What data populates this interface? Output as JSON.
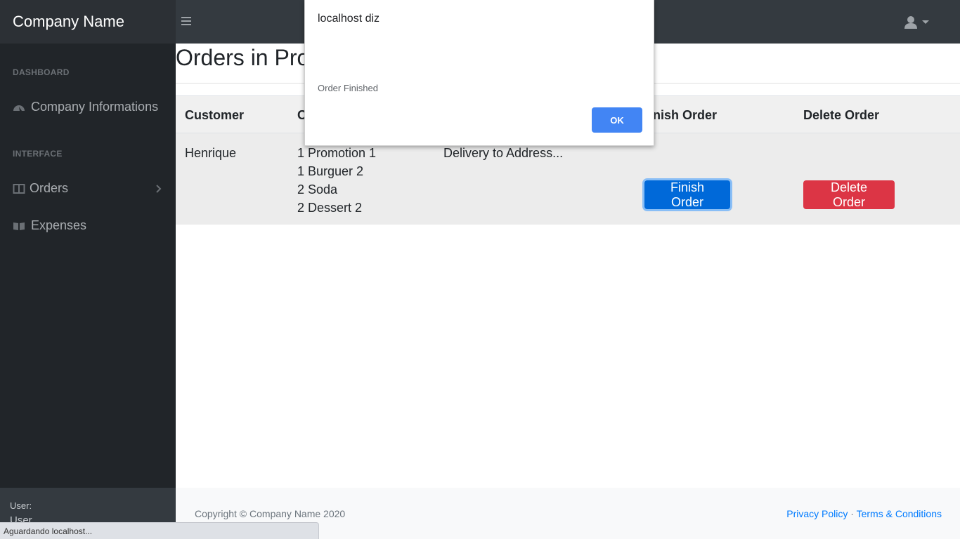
{
  "navbar": {
    "brand": "Company Name"
  },
  "sidebar": {
    "headings": [
      "DASHBOARD",
      "INTERFACE"
    ],
    "items": [
      {
        "label": "Company Informations",
        "icon": "tachometer-icon"
      },
      {
        "label": "Orders",
        "icon": "columns-icon"
      },
      {
        "label": "Expenses",
        "icon": "book-icon"
      }
    ],
    "footer": {
      "who_label": "User:",
      "user_name": "User"
    }
  },
  "main": {
    "title": "Orders in Pro",
    "table": {
      "headers": [
        "Customer",
        "O",
        "",
        "nish Order",
        "Delete Order"
      ],
      "rows": [
        {
          "customer": "Henrique",
          "items": [
            "1 Promotion 1",
            "1 Burguer 2",
            "2 Soda",
            "2 Dessert 2"
          ],
          "delivery": "Delivery to Address...",
          "finish_label": "Finish Order",
          "delete_label": "Delete Order"
        }
      ]
    }
  },
  "footer": {
    "copyright": "Copyright © Company Name 2020",
    "privacy": "Privacy Policy",
    "separator": "·",
    "terms": "Terms & Conditions"
  },
  "statusbar": {
    "text": "Aguardando localhost..."
  },
  "dialog": {
    "title": "localhost diz",
    "message": "Order Finished",
    "ok_label": "OK"
  },
  "colors": {
    "navbar": "#343a40",
    "sidebar": "#212529",
    "primary": "#0069d9",
    "danger": "#dc3545",
    "dialog_button": "#4285f4"
  }
}
